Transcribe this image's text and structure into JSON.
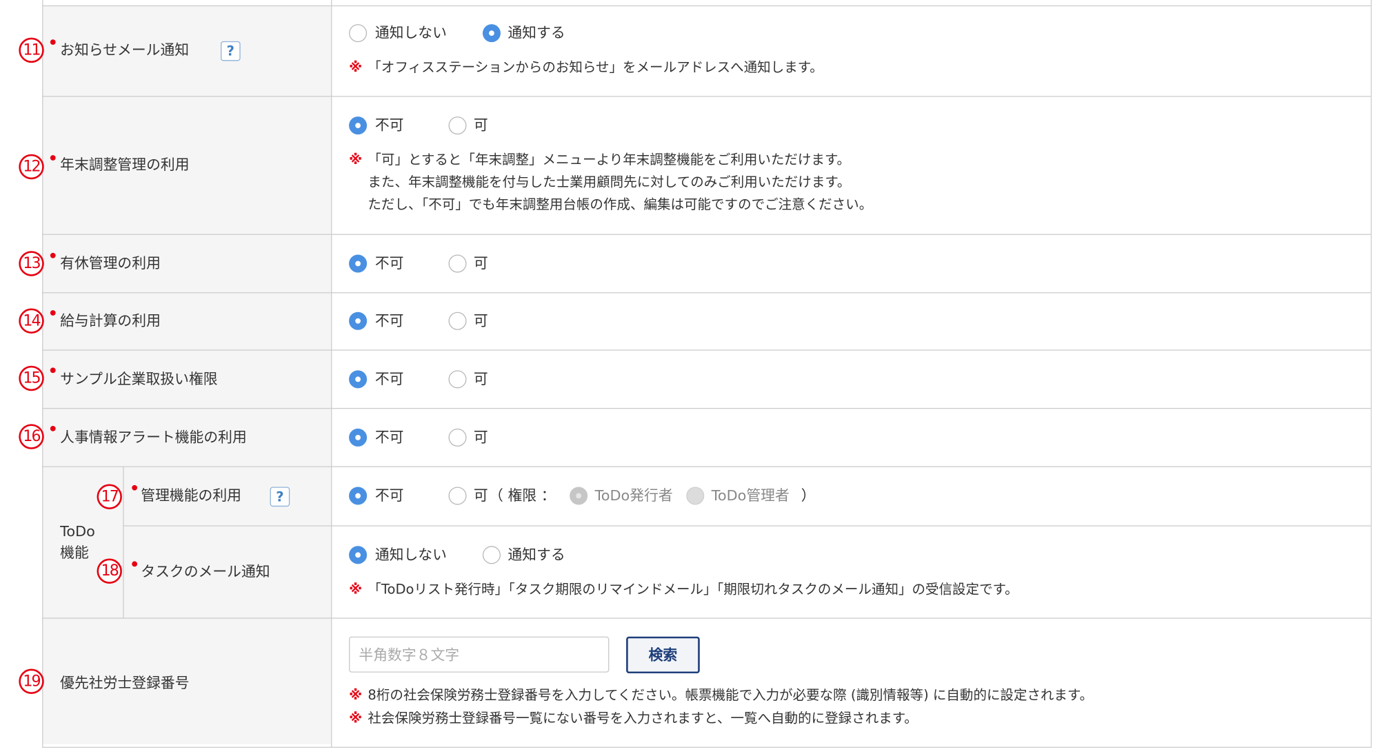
{
  "rows": {
    "mail_notice": {
      "num": "11",
      "label": "お知らせメール通知",
      "options": [
        "通知しない",
        "通知する"
      ],
      "selected": 1,
      "help": "?",
      "note_mark": "※",
      "note": "「オフィスステーションからのお知らせ」をメールアドレスへ通知します。"
    },
    "year_end": {
      "num": "12",
      "label": "年末調整管理の利用",
      "options": [
        "不可",
        "可"
      ],
      "selected": 0,
      "note_mark": "※",
      "note_lines": [
        "「可」とすると「年末調整」メニューより年末調整機能をご利用いただけます。",
        "また、年末調整機能を付与した士業用顧問先に対してのみご利用いただけます。",
        "ただし、「不可」でも年末調整用台帳の作成、編集は可能ですのでご注意ください。"
      ]
    },
    "paid_leave": {
      "num": "13",
      "label": "有休管理の利用",
      "options": [
        "不可",
        "可"
      ],
      "selected": 0
    },
    "payroll": {
      "num": "14",
      "label": "給与計算の利用",
      "options": [
        "不可",
        "可"
      ],
      "selected": 0
    },
    "sample_company": {
      "num": "15",
      "label": "サンプル企業取扱い権限",
      "options": [
        "不可",
        "可"
      ],
      "selected": 0
    },
    "hr_alert": {
      "num": "16",
      "label": "人事情報アラート機能の利用",
      "options": [
        "不可",
        "可"
      ],
      "selected": 0
    },
    "todo": {
      "group_label_line1": "ToDo",
      "group_label_line2": "機能",
      "manage": {
        "num": "17",
        "label": "管理機能の利用",
        "help": "?",
        "options": [
          "不可",
          "可"
        ],
        "selected": 0,
        "perm_open": "（ 権限 ：",
        "perm_options": [
          "ToDo発行者",
          "ToDo管理者"
        ],
        "perm_selected": 0,
        "perm_close": "）"
      },
      "task_mail": {
        "num": "18",
        "label": "タスクのメール通知",
        "options": [
          "通知しない",
          "通知する"
        ],
        "selected": 0,
        "note_mark": "※",
        "note": "「ToDoリスト発行時」「タスク期限のリマインドメール」「期限切れタスクのメール通知」の受信設定です。"
      }
    },
    "sharoushi": {
      "num": "19",
      "label": "優先社労士登録番号",
      "input_placeholder": "半角数字８文字",
      "input_value": "",
      "button": "検索",
      "note_mark": "※",
      "notes": [
        "8桁の社会保険労務士登録番号を入力してください。帳票機能で入力が必要な際 (識別情報等) に自動的に設定されます。",
        "社会保険労務士登録番号一覧にない番号を入力されますと、一覧へ自動的に登録されます。"
      ]
    }
  },
  "colors": {
    "accent": "#4a90e2",
    "required": "#e60012",
    "label_bg": "#f5f5f5",
    "border": "#cccccc",
    "button_border": "#1f3f7a"
  }
}
